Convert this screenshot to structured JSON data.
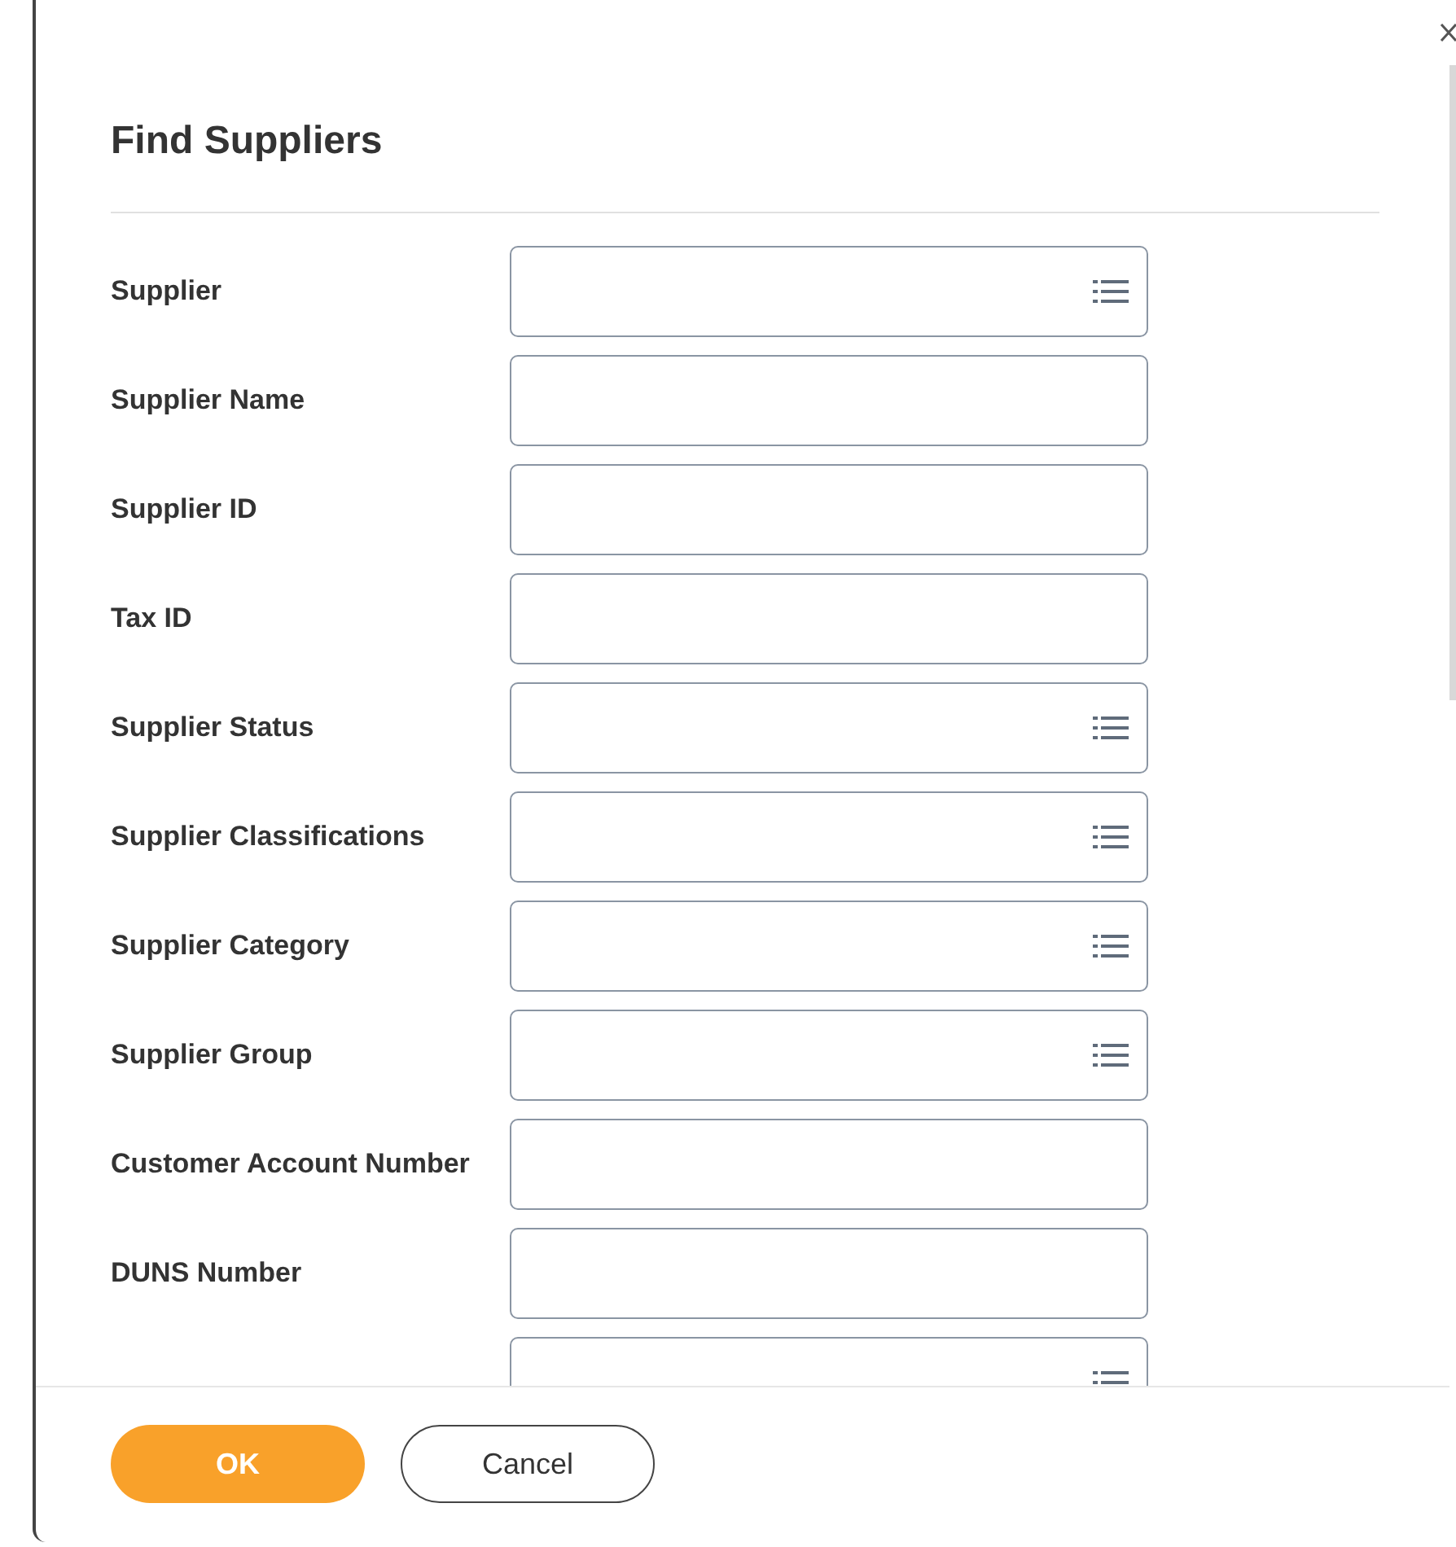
{
  "dialog": {
    "title": "Find Suppliers"
  },
  "fields": [
    {
      "label": "Supplier",
      "kind": "prompt"
    },
    {
      "label": "Supplier Name",
      "kind": "text"
    },
    {
      "label": "Supplier ID",
      "kind": "text"
    },
    {
      "label": "Tax ID",
      "kind": "text"
    },
    {
      "label": "Supplier Status",
      "kind": "prompt"
    },
    {
      "label": "Supplier Classifications",
      "kind": "prompt"
    },
    {
      "label": "Supplier Category",
      "kind": "prompt"
    },
    {
      "label": "Supplier Group",
      "kind": "prompt"
    },
    {
      "label": "Customer Account Number",
      "kind": "text"
    },
    {
      "label": "DUNS Number",
      "kind": "text"
    },
    {
      "kind": "prompt"
    }
  ],
  "buttons": [
    {
      "label": "OK",
      "kind": "primary"
    },
    {
      "label": "Cancel",
      "kind": "secondary"
    }
  ]
}
